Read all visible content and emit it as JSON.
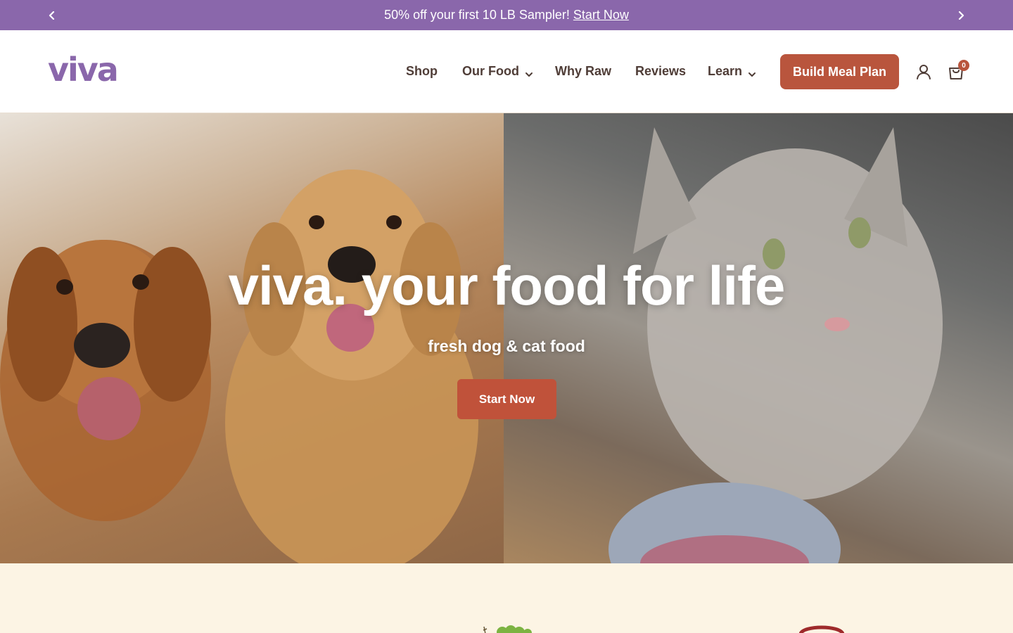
{
  "announcement": {
    "text": "50% off your first 10 LB Sampler!",
    "link_label": "Start Now",
    "prev_icon": "chevron-left-icon",
    "next_icon": "chevron-right-icon"
  },
  "header": {
    "logo_text": "viva",
    "nav": [
      {
        "label": "Shop",
        "has_dropdown": false
      },
      {
        "label": "Our Food",
        "has_dropdown": true
      },
      {
        "label": "Why Raw",
        "has_dropdown": false
      },
      {
        "label": "Reviews",
        "has_dropdown": false
      },
      {
        "label": "Learn",
        "has_dropdown": true
      }
    ],
    "cta_label": "Build Meal Plan",
    "account_icon": "user-icon",
    "cart_icon": "shopping-bag-icon",
    "cart_count": "0"
  },
  "hero": {
    "title": "viva. your food for life",
    "subtitle": "fresh dog & cat food",
    "cta_label": "Start Now"
  },
  "features": {
    "icons": [
      "vegetables-icon",
      "badge-icon"
    ]
  },
  "colors": {
    "brand_purple": "#8a67ab",
    "accent_rust": "#b9553d",
    "cream": "#fcf4e4",
    "text_brown": "#4f3d37"
  }
}
